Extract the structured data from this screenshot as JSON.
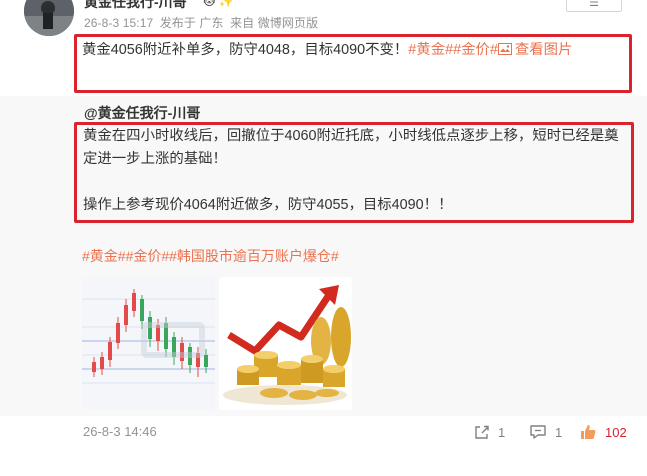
{
  "post": {
    "author": "黄金任我行-川哥",
    "badges": "🐱 ✨",
    "time": "26-8-3 15:17",
    "location": "发布于 广东",
    "source": "来自 微博网页版",
    "follow_label": "☰",
    "text_before": "黄金4056附近补单多，防守4048，目标4090不变！",
    "tag_gold": "#黄金#",
    "tag_price": "#金价#",
    "view_image_icon": "image-icon",
    "view_image_label": "查看图片"
  },
  "repost": {
    "author": "@黄金任我行-川哥",
    "paragraph1": "黄金在四小时收线后，回撤位于4060附近托底，小时线低点逐步上移，短时已经是奠定进一步上涨的基础！",
    "paragraph2": "操作上参考现价4064附近做多，防守4055，目标4090！！",
    "tags": "#黄金##金价##韩国股市逾百万账户爆仓#",
    "time": "26-8-3 14:46",
    "share_count": "1",
    "comment_count": "1",
    "like_count": "102"
  },
  "colors": {
    "tag": "#eb7350",
    "highlight_box": "#d9232e",
    "muted": "#939393"
  }
}
